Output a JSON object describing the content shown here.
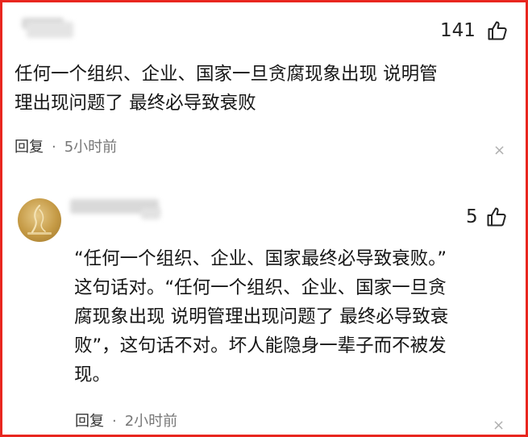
{
  "comment1": {
    "likes": "141",
    "text_lines": [
      "任何一个组织、企业、国家一旦贪腐现象出现 说明管",
      "理出现问题了 最终必导致衰败"
    ],
    "reply_label": "回复",
    "separator": "·",
    "time": "5小时前",
    "close": "×"
  },
  "comment2": {
    "likes": "5",
    "text_lines": [
      "“任何一个组织、企业、国家最终必导致衰败。”",
      "这句话对。“任何一个组织、企业、国家一旦贪",
      "腐现象出现 说明管理出现问题了 最终必导致衰",
      "败”，这句话不对。坏人能隐身一辈子而不被发",
      "现。"
    ],
    "reply_label": "回复",
    "separator": "·",
    "time": "2小时前",
    "close": "×"
  },
  "colors": {
    "border": "#e8261f",
    "text": "#161616",
    "muted": "#777777",
    "avatar_gold": "#c59a45"
  },
  "icons": [
    "thumbs-up-icon",
    "close-icon"
  ]
}
